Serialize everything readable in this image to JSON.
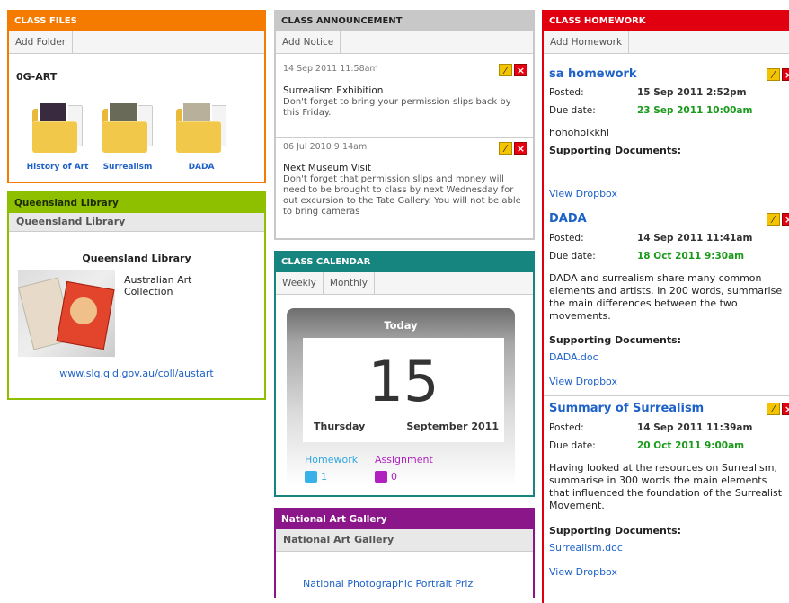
{
  "colors": {
    "files": "#f47a00",
    "library": "#8ec000",
    "announce": "#c8c8c8",
    "calendar": "#16847f",
    "gallery": "#8a168a",
    "homework": "#e0000f",
    "link": "#1e62c8",
    "green": "#1a9a1a"
  },
  "files": {
    "title": "CLASS FILES",
    "add_label": "Add Folder",
    "folder_name": "0G-ART",
    "folders": [
      {
        "label": "History of Art"
      },
      {
        "label": "Surrealism"
      },
      {
        "label": "DADA"
      }
    ]
  },
  "library": {
    "title": "Queensland Library",
    "sub": "Queensland Library",
    "heading": "Queensland Library",
    "item": "Australian Art Collection",
    "link": "www.slq.qld.gov.au/coll/austart"
  },
  "announce": {
    "title": "CLASS ANNOUNCEMENT",
    "add_label": "Add Notice",
    "items": [
      {
        "date": "14 Sep 2011 11:58am",
        "title": "Surrealism Exhibition",
        "body": "Don't forget to bring your permission slips back by this Friday."
      },
      {
        "date": "06 Jul 2010 9:14am",
        "title": "Next Museum Visit",
        "body": "Don't forget that permission slips and money will need to be brought to class by next Wednesday for out excursion to the Tate Gallery. You will not be able to bring cameras"
      }
    ]
  },
  "calendar": {
    "title": "CLASS CALENDAR",
    "tabs": [
      "Weekly",
      "Monthly"
    ],
    "today": "Today",
    "day": "15",
    "weekday": "Thursday",
    "month": "September 2011",
    "homework_label": "Homework",
    "homework_count": "1",
    "assignment_label": "Assignment",
    "assignment_count": "0"
  },
  "gallery": {
    "title": "National Art Gallery",
    "sub": "National Art Gallery",
    "link": "National Photographic Portrait Priz"
  },
  "homework": {
    "title": "CLASS HOMEWORK",
    "add_label": "Add Homework",
    "posted_label": "Posted:",
    "due_label": "Due date:",
    "support_label": "Supporting Documents",
    "dropbox": "View Dropbox",
    "items": [
      {
        "title": "sa homework",
        "posted": "15 Sep 2011 2:52pm",
        "due": "23 Sep 2011 10:00am",
        "body": "hohoholkkhl",
        "doc": ""
      },
      {
        "title": "DADA",
        "posted": "14 Sep 2011 11:41am",
        "due": "18 Oct 2011 9:30am",
        "body": "DADA and surrealism share many common elements and artists. In 200 words, summarise the main differences between the two movements.",
        "doc": "DADA.doc"
      },
      {
        "title": "Summary of Surrealism",
        "posted": "14 Sep 2011 11:39am",
        "due": "20 Oct 2011 9:00am",
        "body": "Having looked at the resources on Surrealism, summarise in 300 words the main elements that influenced the foundation of the Surrealist Movement.",
        "doc": "Surrealism.doc"
      }
    ]
  }
}
